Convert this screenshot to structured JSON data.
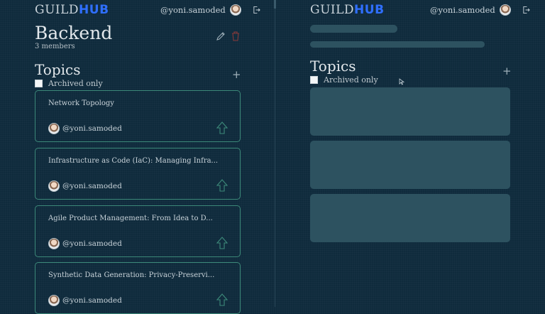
{
  "app": {
    "logo_guild": "GUILD",
    "logo_hub": "HUB",
    "username": "@yoni.samoded"
  },
  "group": {
    "name": "Backend",
    "members": "3 members"
  },
  "topics": {
    "heading": "Topics",
    "archived_label": "Archived only",
    "items": [
      {
        "title": "Network Topology",
        "author": "@yoni.samoded"
      },
      {
        "title": "Infrastructure as Code (IaC): Managing Infra...",
        "author": "@yoni.samoded"
      },
      {
        "title": "Agile Product Management: From Idea to D...",
        "author": "@yoni.samoded"
      },
      {
        "title": "Synthetic Data Generation: Privacy-Preservi...",
        "author": "@yoni.samoded"
      }
    ]
  },
  "colors": {
    "background": "#0f2b3c",
    "accent": "#2f6fff",
    "card_border": "#3d8a7a",
    "skeleton": "#2d5260"
  },
  "icons": [
    "edit-icon",
    "trash-icon",
    "plus-icon",
    "upvote-icon",
    "logout-icon",
    "avatar"
  ]
}
